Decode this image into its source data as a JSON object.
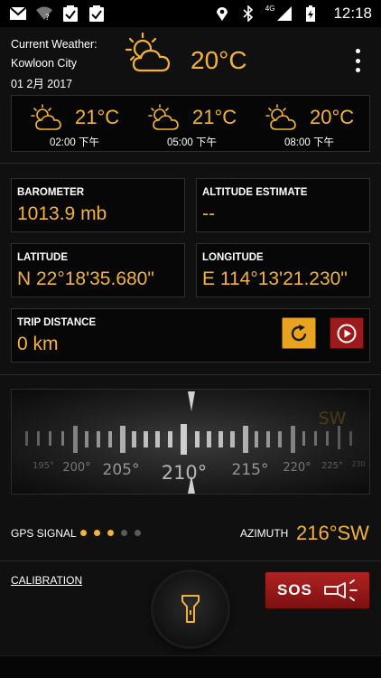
{
  "status_bar": {
    "time": "12:18",
    "network_label": "4G",
    "icons": [
      "gmail-icon",
      "wifi-question-icon",
      "clipboard-check-icon",
      "clipboard-check-icon",
      "location-icon",
      "bluetooth-icon",
      "signal-icon",
      "battery-charging-icon"
    ]
  },
  "weather": {
    "label": "Current Weather:",
    "city": "Kowloon City",
    "date": "01 2月 2017",
    "temp": "20°C",
    "forecast": [
      {
        "temp": "21°C",
        "time": "02:00 下午"
      },
      {
        "temp": "21°C",
        "time": "05:00 下午"
      },
      {
        "temp": "20°C",
        "time": "08:00 下午"
      }
    ]
  },
  "tiles": {
    "barometer": {
      "label": "BAROMETER",
      "value": "1013.9 mb"
    },
    "altitude": {
      "label": "ALTITUDE ESTIMATE",
      "value": "--"
    },
    "latitude": {
      "label": "LATITUDE",
      "value": "N 22°18'35.680\""
    },
    "longitude": {
      "label": "LONGITUDE",
      "value": "E 114°13'21.230\""
    },
    "trip": {
      "label": "TRIP DISTANCE",
      "value": "0 km"
    }
  },
  "compass": {
    "ticks": [
      "195°",
      "200°",
      "205°",
      "210°",
      "215°",
      "220°",
      "225°",
      "230"
    ],
    "direction": "SW"
  },
  "gps": {
    "label": "GPS SIGNAL",
    "signal_level": 3,
    "max_level": 5,
    "on_color": "#f3b338",
    "off_color": "#5a5a5a"
  },
  "azimuth": {
    "label": "AZIMUTH",
    "value": "216°SW"
  },
  "calibration": {
    "label": "CALIBRATION"
  },
  "sos": {
    "label": "SOS"
  },
  "colors": {
    "accent": "#f3b338",
    "sos_red": "#b02222"
  }
}
